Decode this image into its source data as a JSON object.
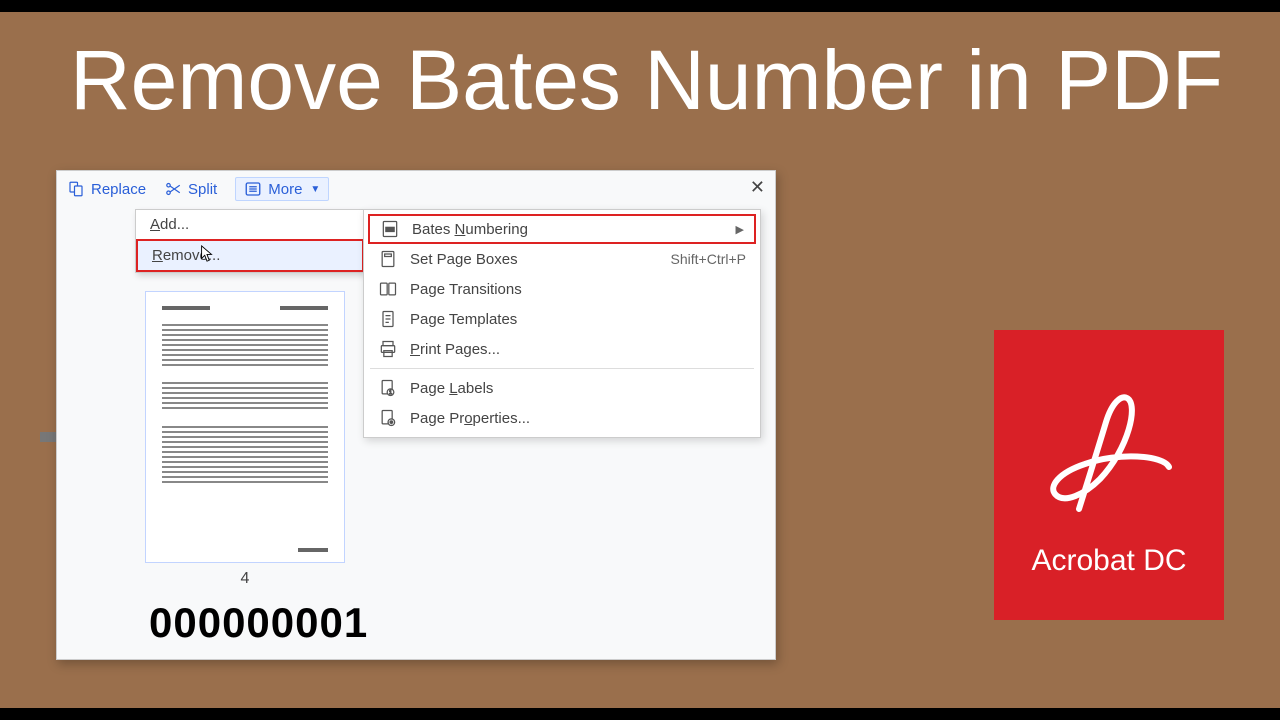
{
  "title": "Remove Bates Number in PDF",
  "toolbar": {
    "replace": "Replace",
    "split": "Split",
    "more": "More"
  },
  "ctx_left": {
    "add": "Add...",
    "remove": "Remove..."
  },
  "menu": {
    "bates": "Bates Numbering",
    "set_boxes": "Set Page Boxes",
    "set_boxes_sc": "Shift+Ctrl+P",
    "transitions": "Page Transitions",
    "templates": "Page Templates",
    "print": "Print Pages...",
    "labels": "Page Labels",
    "properties": "Page Properties..."
  },
  "thumb_page": "4",
  "bates_number": "000000001",
  "logo_caption": "Acrobat DC"
}
